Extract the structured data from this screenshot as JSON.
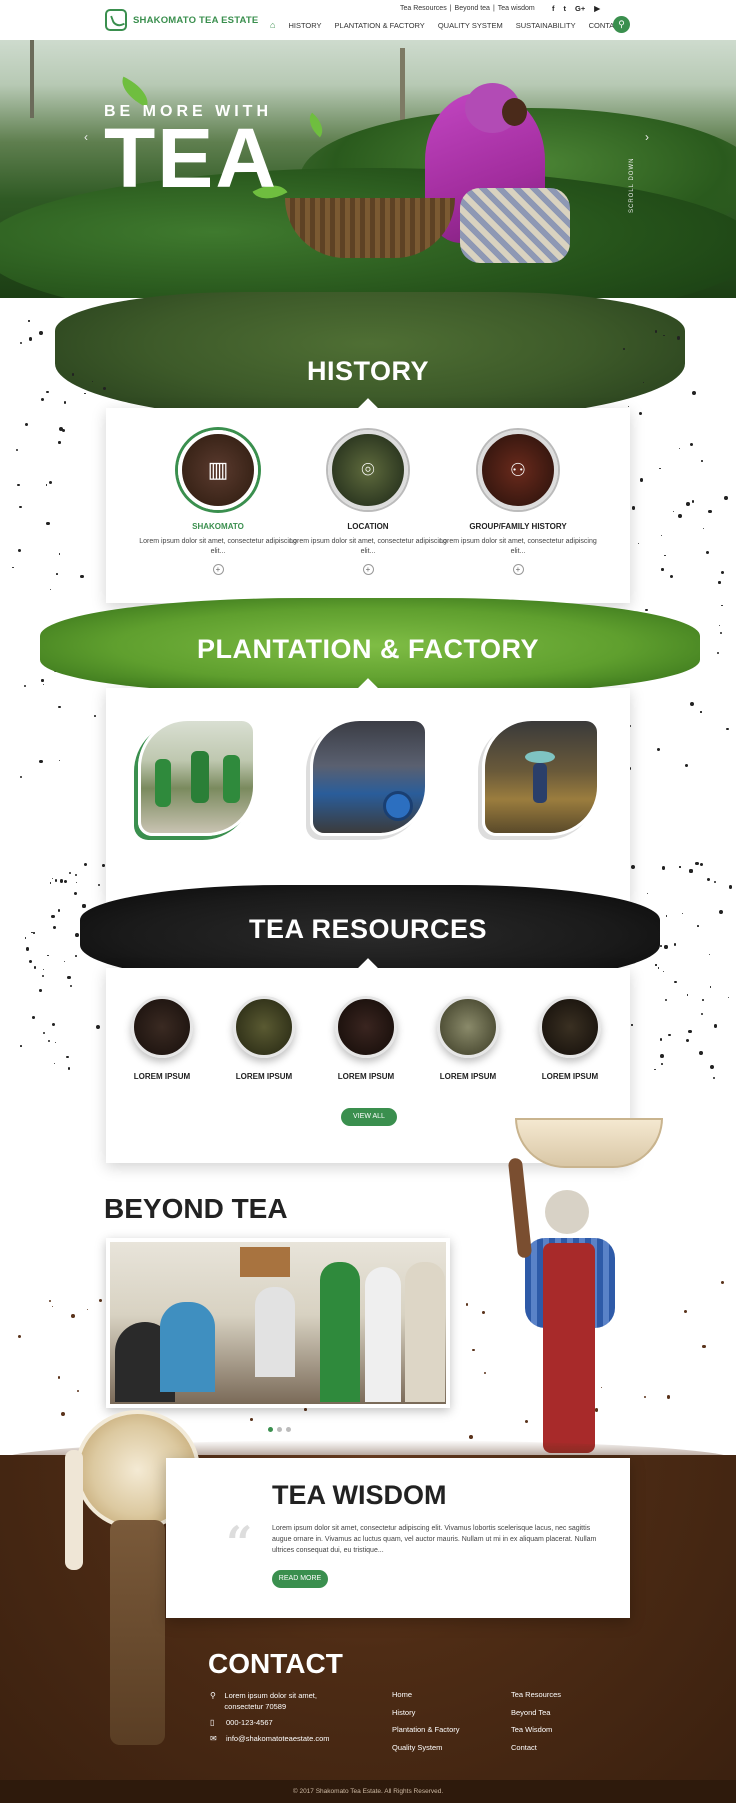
{
  "brand": {
    "name": "SHAKOMATO TEA ESTATE",
    "accent": "#3a8f4e"
  },
  "top_links": [
    "Tea Resources",
    "|",
    "Beyond tea",
    "|",
    "Tea wisdom"
  ],
  "social": [
    "f",
    "t",
    "G+",
    "▶"
  ],
  "nav": [
    "HISTORY",
    "PLANTATION & FACTORY",
    "QUALITY SYSTEM",
    "SUSTAINABILITY",
    "CONTACT"
  ],
  "hero": {
    "small": "BE MORE WITH",
    "big": "TEA",
    "scroll": "SCROLL DOWN"
  },
  "history": {
    "title": "HISTORY",
    "items": [
      {
        "title": "SHAKOMATO",
        "text": "Lorem ipsum dolor sit amet, consectetur adipiscing elit...",
        "icon": "factory-icon"
      },
      {
        "title": "LOCATION",
        "text": "Lorem ipsum dolor sit amet, consectetur adipiscing elit...",
        "icon": "location-pin-icon"
      },
      {
        "title": "GROUP/FAMILY HISTORY",
        "text": "Lorem ipsum dolor sit amet, consectetur adipiscing elit...",
        "icon": "group-icon"
      }
    ]
  },
  "plantation": {
    "title": "PLANTATION & FACTORY"
  },
  "resources": {
    "title": "TEA RESOURCES",
    "items": [
      "LOREM IPSUM",
      "LOREM IPSUM",
      "LOREM IPSUM",
      "LOREM IPSUM",
      "LOREM IPSUM"
    ],
    "view_all": "VIEW ALL"
  },
  "beyond": {
    "title": "BEYOND TEA"
  },
  "wisdom": {
    "title": "TEA WISDOM",
    "text": "Lorem ipsum dolor sit amet, consectetur adipiscing elit. Vivamus lobortis scelerisque lacus, nec sagittis augue ornare in. Vivamus ac luctus quam, vel auctor mauris. Nullam ut mi in ex aliquam placerat. Nullam ultrices consequat dui, eu tristique...",
    "read_more": "READ MORE"
  },
  "contact": {
    "title": "CONTACT",
    "address": "Lorem ipsum dolor sit amet, consectetur 70589",
    "phone": "000-123-4567",
    "email": "info@shakomatoteaestate.com",
    "links_col1": [
      "Home",
      "History",
      "Plantation & Factory",
      "Quality System"
    ],
    "links_col2": [
      "Tea Resources",
      "Beyond Tea",
      "Tea Wisdom",
      "Contact"
    ]
  },
  "footer": "© 2017 Shakomato Tea Estate. All Rights Reserved."
}
